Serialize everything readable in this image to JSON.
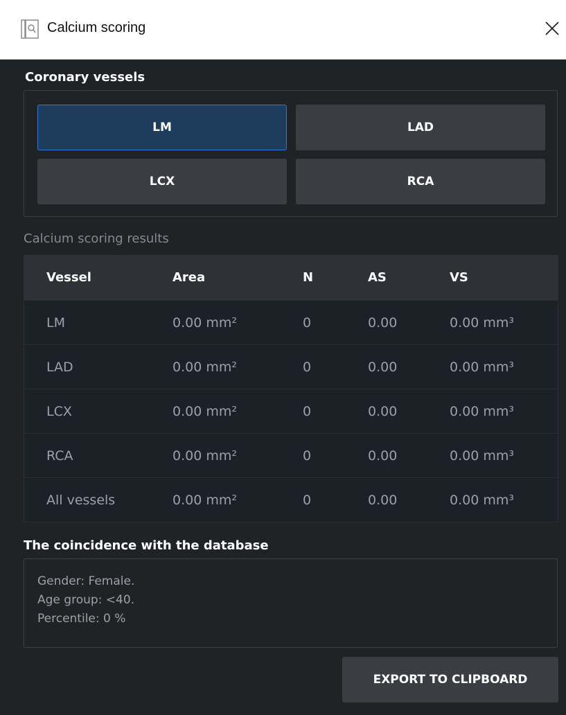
{
  "window": {
    "title": "Calcium scoring",
    "app_icon": "calcium-scoring-icon",
    "close_icon": "close-icon"
  },
  "vessels": {
    "heading": "Coronary vessels",
    "buttons": [
      {
        "label": "LM",
        "active": true
      },
      {
        "label": "LAD",
        "active": false
      },
      {
        "label": "LCX",
        "active": false
      },
      {
        "label": "RCA",
        "active": false
      }
    ]
  },
  "results": {
    "heading": "Calcium scoring results",
    "columns": [
      "Vessel",
      "Area",
      "N",
      "AS",
      "VS"
    ],
    "rows": [
      [
        "LM",
        "0.00 mm²",
        "0",
        "0.00",
        "0.00 mm³"
      ],
      [
        "LAD",
        "0.00 mm²",
        "0",
        "0.00",
        "0.00 mm³"
      ],
      [
        "LCX",
        "0.00 mm²",
        "0",
        "0.00",
        "0.00 mm³"
      ],
      [
        "RCA",
        "0.00 mm²",
        "0",
        "0.00",
        "0.00 mm³"
      ],
      [
        "All vessels",
        "0.00 mm²",
        "0",
        "0.00",
        "0.00 mm³"
      ]
    ]
  },
  "database": {
    "heading": "The coincidence with the database",
    "lines": [
      "Gender: Female.",
      "Age group: <40.",
      "Percentile: 0 %"
    ]
  },
  "export_label": "EXPORT TO CLIPBOARD",
  "colors": {
    "background": "#202326",
    "active_button": "#1e3c5c",
    "active_border": "#2f7ad0",
    "button": "#3a3d41"
  }
}
